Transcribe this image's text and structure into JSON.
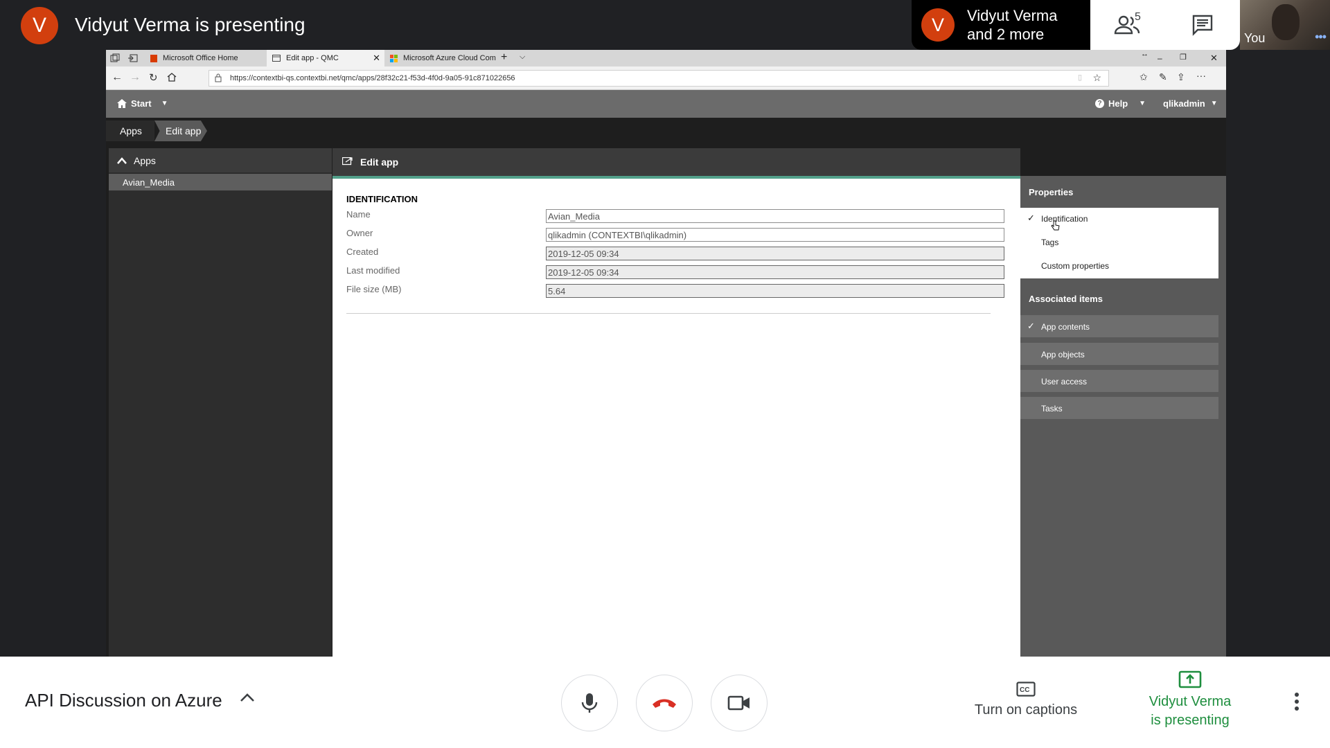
{
  "meet": {
    "presenter_initial": "V",
    "presenting_title": "Vidyut Verma is presenting",
    "others_initial": "V",
    "others_line1": "Vidyut Verma",
    "others_line2": "and 2 more",
    "participants_count": "5",
    "self_label": "You",
    "meeting_name": "API Discussion on Azure",
    "captions_label": "Turn on captions",
    "presenting_line1": "Vidyut Verma",
    "presenting_line2": "is presenting",
    "colors": {
      "accent": "#1e8e3e",
      "avatar": "#d23f0e",
      "end_call": "#d93025"
    }
  },
  "browser": {
    "tabs": [
      {
        "label": "Microsoft Office Home"
      },
      {
        "label": "Edit app - QMC"
      },
      {
        "label": "Microsoft Azure Cloud Com"
      }
    ],
    "url": "https://contextbi-qs.contextbi.net/qmc/apps/28f32c21-f53d-4f0d-9a05-91c871022656"
  },
  "qmc": {
    "start_label": "Start",
    "help_label": "Help",
    "user_label": "qlikadmin",
    "breadcrumb": [
      "Apps",
      "Edit app"
    ],
    "left_panel": {
      "header": "Apps",
      "items": [
        "Avian_Media"
      ]
    },
    "main_title": "Edit app",
    "section_title": "IDENTIFICATION",
    "fields": [
      {
        "label": "Name",
        "value": "Avian_Media"
      },
      {
        "label": "Owner",
        "value": "qlikadmin (CONTEXTBI\\qlikadmin)"
      },
      {
        "label": "Created",
        "value": "2019-12-05 09:34"
      },
      {
        "label": "Last modified",
        "value": "2019-12-05 09:34"
      },
      {
        "label": "File size (MB)",
        "value": "5.64"
      }
    ],
    "properties_title": "Properties",
    "properties_items": [
      "Identification",
      "Tags",
      "Custom properties"
    ],
    "associated_title": "Associated items",
    "associated_items": [
      "App contents",
      "App objects",
      "User access",
      "Tasks"
    ]
  }
}
